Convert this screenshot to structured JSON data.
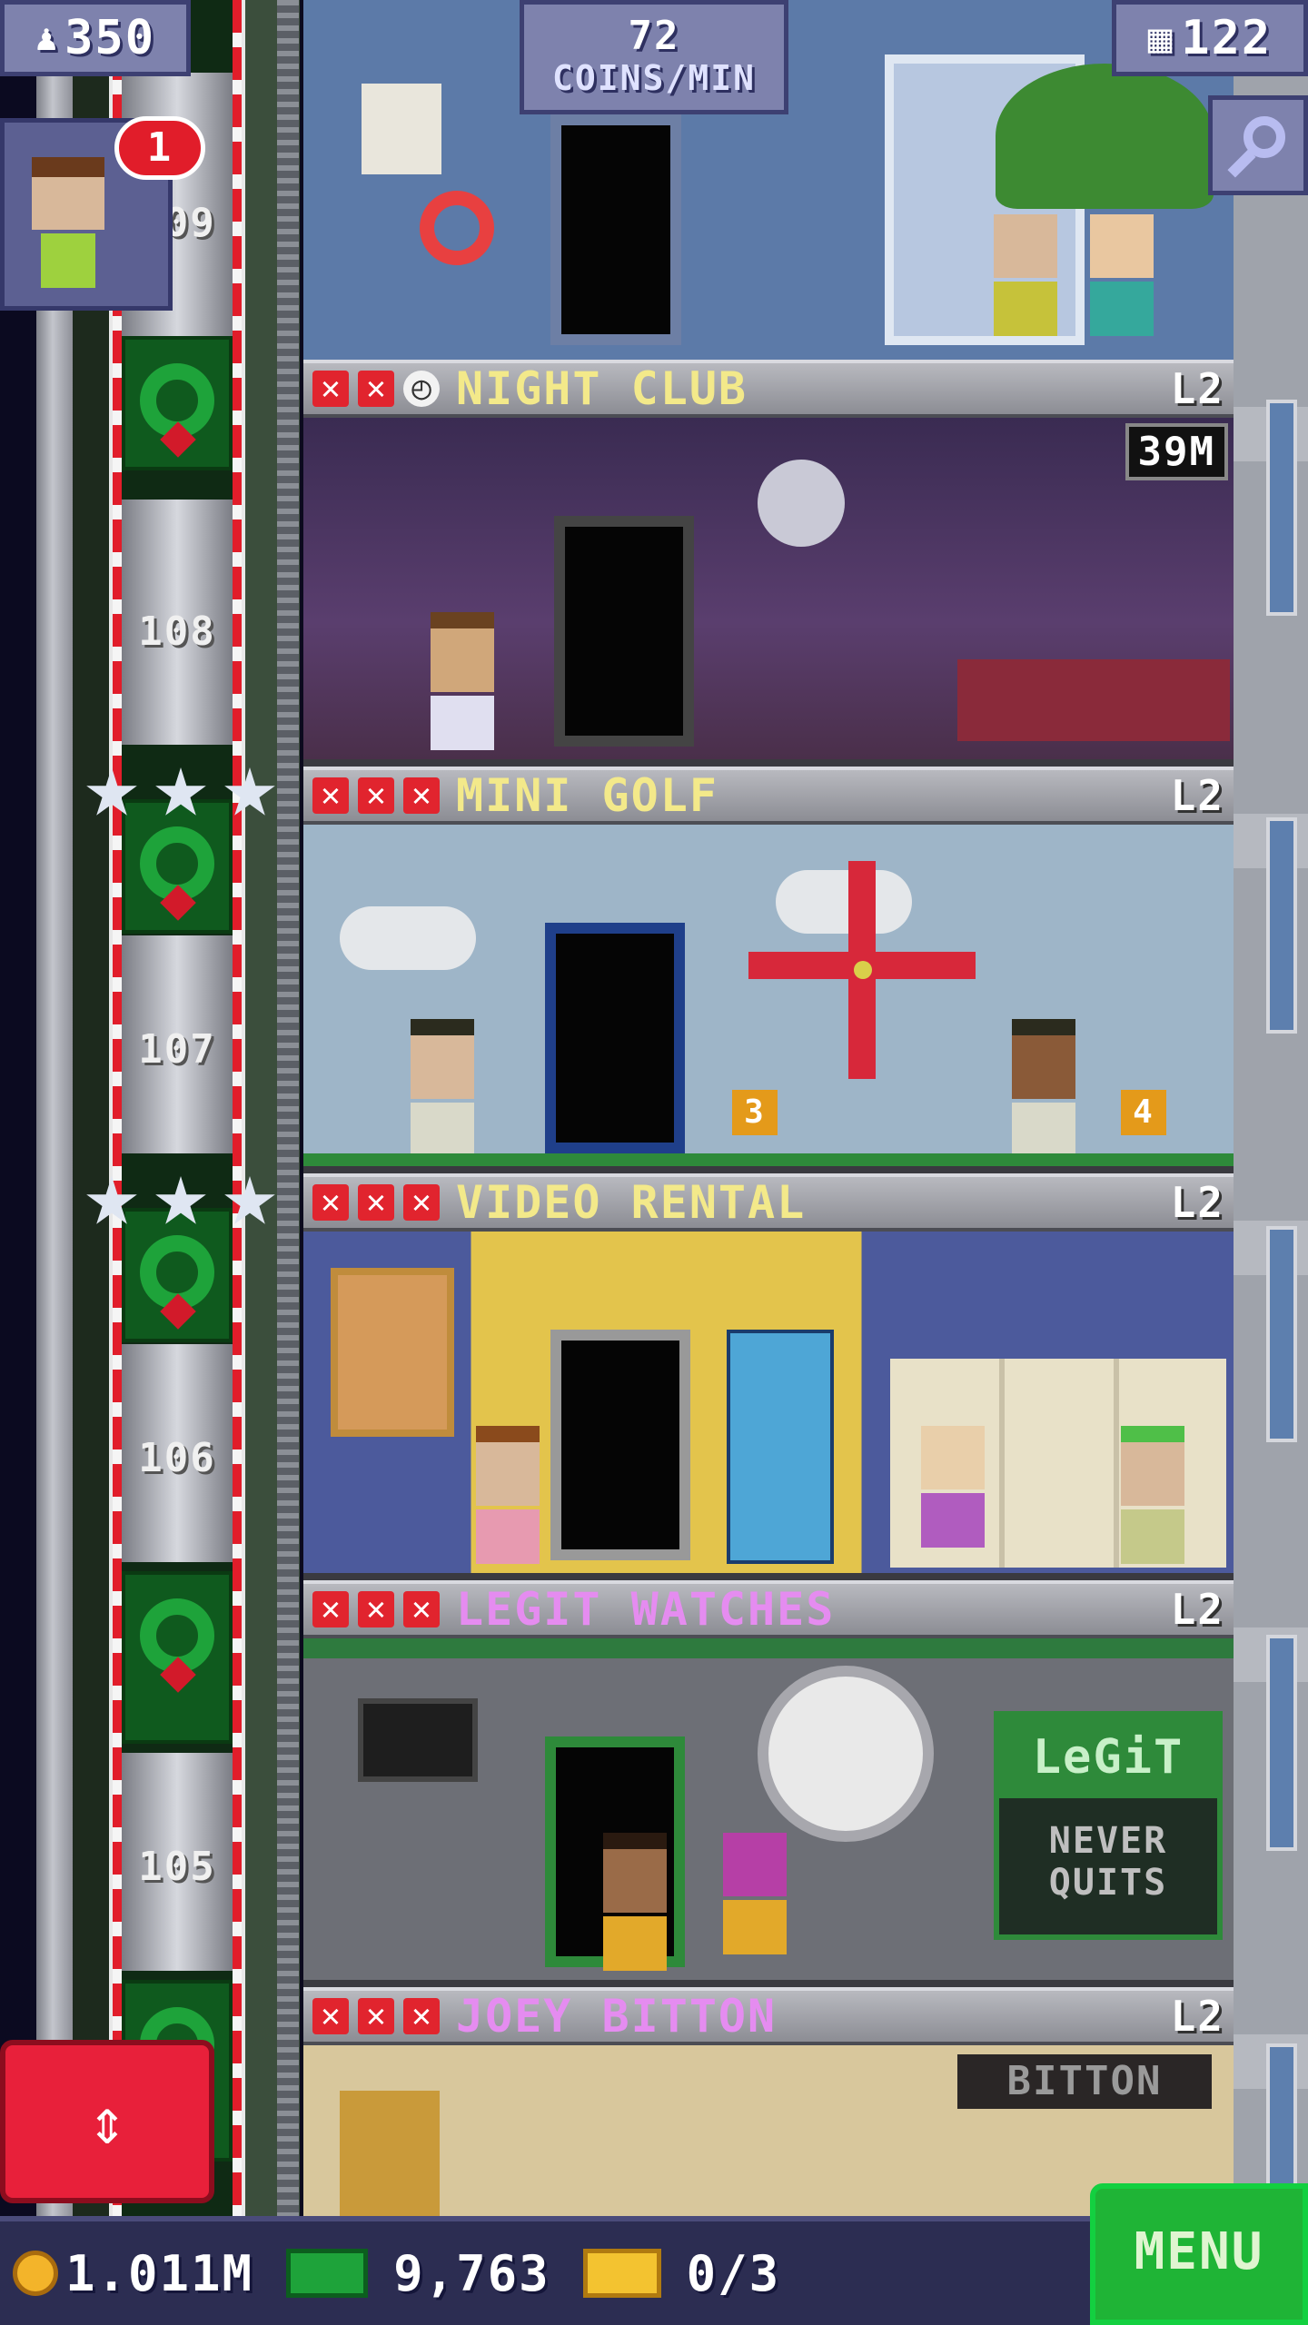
{
  "hud": {
    "population": "350",
    "coins_per_min_value": "72",
    "coins_per_min_label": "COINS/MIN",
    "floors": "122",
    "notification_count": "1"
  },
  "floors": [
    {
      "number": "109"
    },
    {
      "number": "108"
    },
    {
      "number": "107"
    },
    {
      "number": "106"
    },
    {
      "number": "105"
    }
  ],
  "rooms": [
    {
      "name": "NIGHT CLUB",
      "level": "L2",
      "timer": "39M",
      "name_color": "#f3e98a"
    },
    {
      "name": "MINI GOLF",
      "level": "L2",
      "name_color": "#f3e98a"
    },
    {
      "name": "VIDEO RENTAL",
      "level": "L2",
      "name_color": "#f3e98a"
    },
    {
      "name": "LEGIT WATCHES",
      "level": "L2",
      "name_color": "#e58cf0",
      "sign1": "LeGiT",
      "sign2": "NEVER",
      "sign3": "QUITS"
    },
    {
      "name": "JOEY BITTON",
      "level": "L2",
      "name_color": "#e58cf0",
      "sign": "BITTON"
    }
  ],
  "golf_holes": [
    "3",
    "4"
  ],
  "bottom_bar": {
    "coins": "1.011M",
    "bux": "9,763",
    "tickets": "0/3",
    "menu_label": "MENU"
  },
  "colors": {
    "accent_red": "#e11d2a",
    "menu_green": "#1fb436",
    "hud_purple": "#7e82ad"
  },
  "icons": [
    "population-icon",
    "floors-icon",
    "magnify-icon",
    "elevator-arrows-icon",
    "coin-icon",
    "bux-icon",
    "ticket-icon",
    "vip-x-icon",
    "clock-icon",
    "wreath-icon",
    "star-icon"
  ]
}
